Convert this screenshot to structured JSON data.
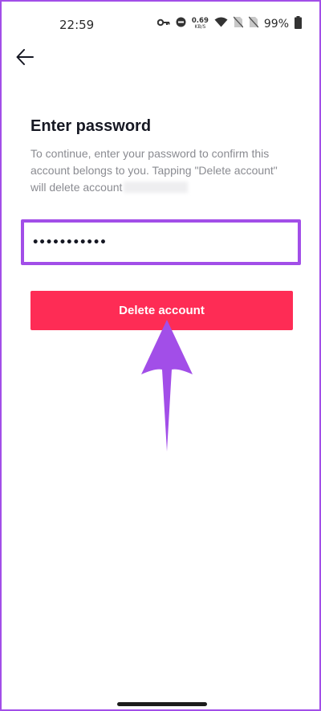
{
  "status_bar": {
    "time": "22:59",
    "net_speed_value": "0.69",
    "net_speed_unit": "KB/S",
    "battery": "99%",
    "icons": [
      "key-icon",
      "do-not-disturb-icon",
      "wifi-icon",
      "no-sim-icon",
      "no-sim-icon",
      "battery-icon"
    ]
  },
  "nav": {
    "back_icon": "back-arrow-icon"
  },
  "page": {
    "title": "Enter password",
    "description": "To continue, enter your password to confirm this account belongs to you. Tapping \"Delete account\" will delete account"
  },
  "password_field": {
    "value": "•••••••••••"
  },
  "actions": {
    "delete_label": "Delete account"
  },
  "colors": {
    "accent": "#fe2c55",
    "annotation": "#a24ee8",
    "text_secondary": "#8a8b91"
  }
}
